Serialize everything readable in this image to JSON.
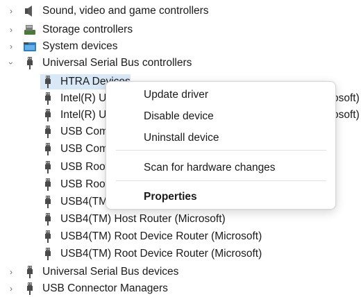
{
  "tree": {
    "items": [
      {
        "label": "Sound, video and game controllers",
        "expander": "chevron-right",
        "icon": "speaker-icon"
      },
      {
        "label": "Storage controllers",
        "expander": "chevron-right",
        "icon": "storage-controller-icon"
      },
      {
        "label": "System devices",
        "expander": "chevron-right",
        "icon": "system-folder-icon"
      },
      {
        "label": "Universal Serial Bus controllers",
        "expander": "chevron-down",
        "icon": "usb-plug-icon"
      },
      {
        "label": "HTRA Devices",
        "icon": "usb-plug-icon",
        "selected": true
      },
      {
        "label": "Intel(R) USB 3.20 eXtensible Host Controller - 1.20 (Microsoft)",
        "visible_label": "Intel(R) U:",
        "icon": "usb-plug-icon"
      },
      {
        "label": "Intel(R) USB 3.20 eXtensible Host Controller - 1.20 (Microsoft)",
        "visible_label": "Intel(R) U:",
        "icon": "usb-plug-icon"
      },
      {
        "label": "USB Composite Device",
        "visible_label": "USB Com",
        "icon": "usb-plug-icon"
      },
      {
        "label": "USB Composite Device",
        "visible_label": "USB Com",
        "icon": "usb-plug-icon"
      },
      {
        "label": "USB Root Hub (USB 3.0)",
        "visible_label": "USB Root",
        "icon": "usb-plug-icon"
      },
      {
        "label": "USB Root Hub (USB 3.0)",
        "visible_label": "USB Root",
        "icon": "usb-plug-icon"
      },
      {
        "label": "USB4(TM) Host Router (Microsoft)",
        "visible_label": "USB4(TM)",
        "icon": "usb-plug-icon"
      },
      {
        "label": "USB4(TM) Host Router (Microsoft)",
        "icon": "usb-plug-icon"
      },
      {
        "label": "USB4(TM) Root Device Router (Microsoft)",
        "icon": "usb-plug-icon"
      },
      {
        "label": "USB4(TM) Root Device Router (Microsoft)",
        "icon": "usb-plug-icon"
      },
      {
        "label": "Universal Serial Bus devices",
        "expander": "chevron-right",
        "icon": "usb-plug-icon"
      },
      {
        "label": "USB Connector Managers",
        "expander": "chevron-right",
        "icon": "usb-plug-icon"
      }
    ],
    "clipped_suffix": "osoft)",
    "selection_color": "#d9e8f6"
  },
  "context_menu": {
    "items": [
      {
        "label": "Update driver"
      },
      {
        "label": "Disable device"
      },
      {
        "label": "Uninstall device"
      },
      {
        "label": "Scan for hardware changes"
      },
      {
        "label": "Properties",
        "bold": true
      }
    ]
  }
}
